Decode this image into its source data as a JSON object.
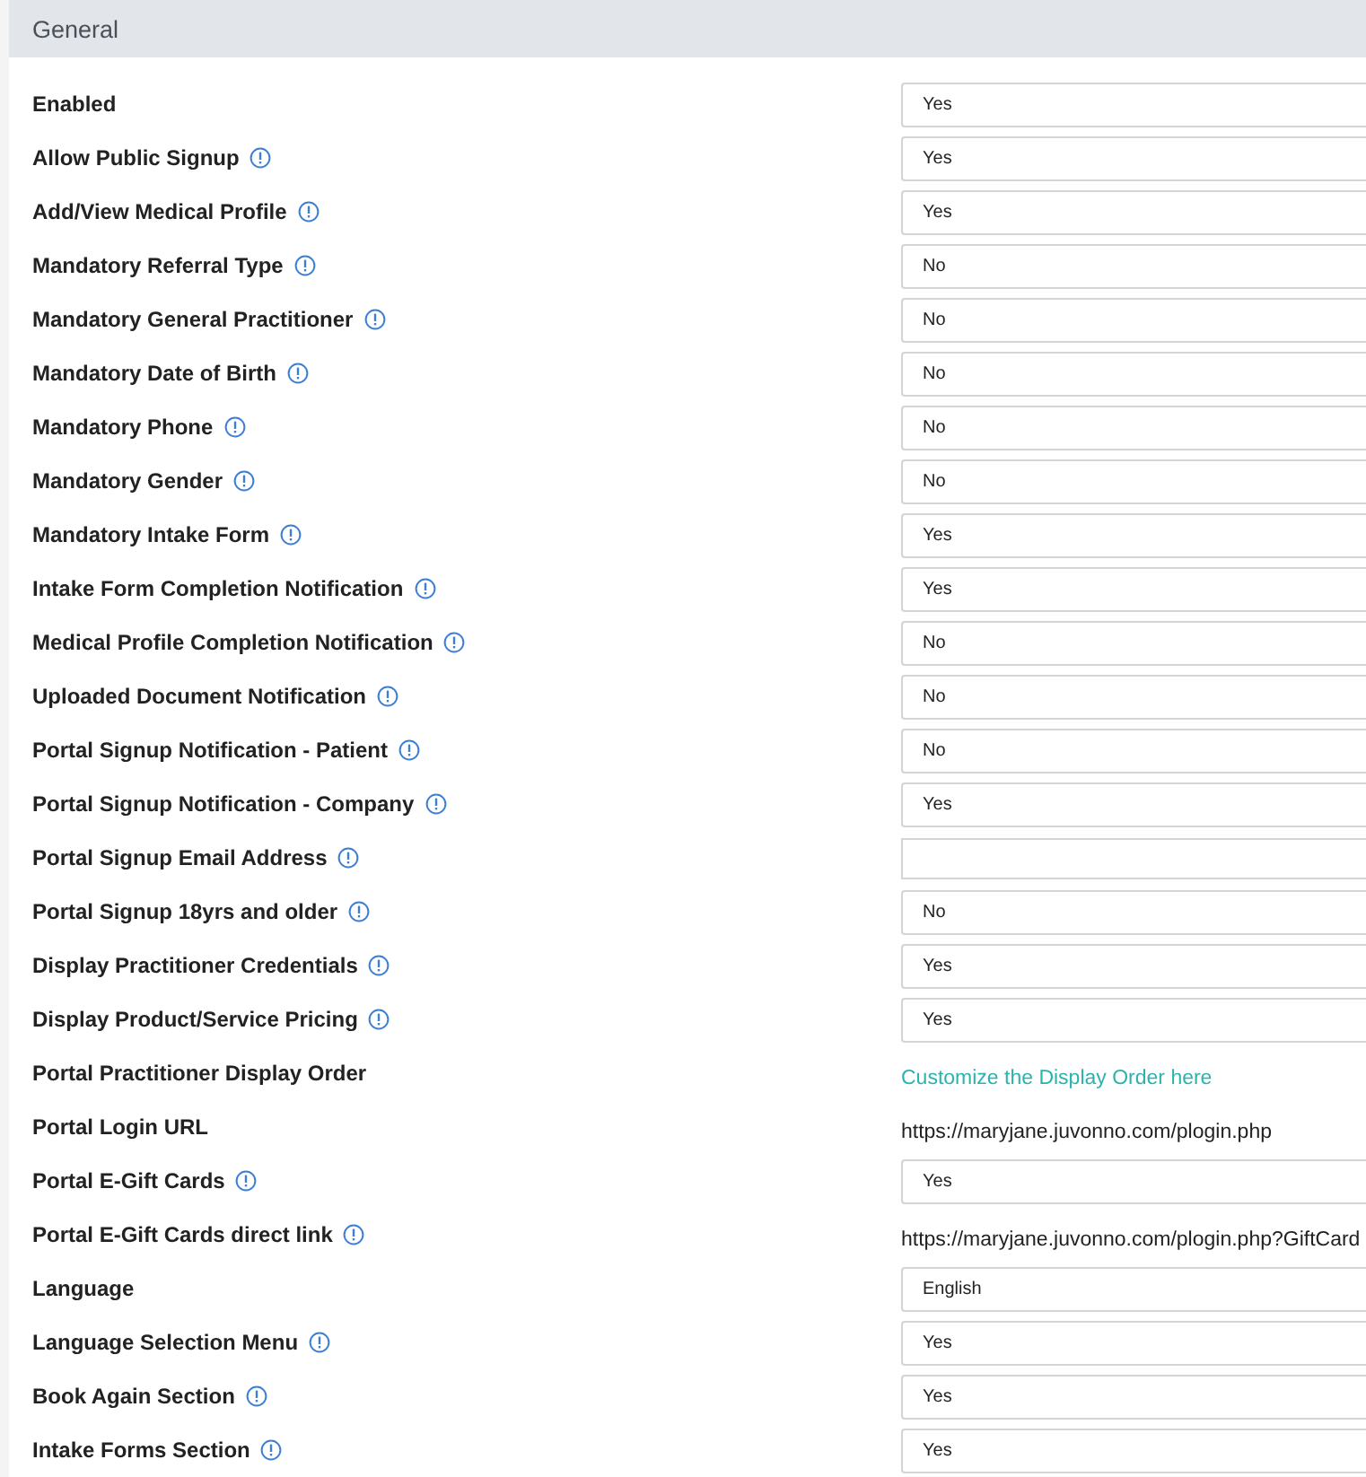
{
  "section": {
    "title": "General"
  },
  "settings": [
    {
      "label": "Enabled",
      "info": false,
      "kind": "select",
      "value": "Yes"
    },
    {
      "label": "Allow Public Signup",
      "info": true,
      "kind": "select",
      "value": "Yes"
    },
    {
      "label": "Add/View Medical Profile",
      "info": true,
      "kind": "select",
      "value": "Yes"
    },
    {
      "label": "Mandatory Referral Type",
      "info": true,
      "kind": "select",
      "value": "No"
    },
    {
      "label": "Mandatory General Practitioner",
      "info": true,
      "kind": "select",
      "value": "No"
    },
    {
      "label": "Mandatory Date of Birth",
      "info": true,
      "kind": "select",
      "value": "No"
    },
    {
      "label": "Mandatory Phone",
      "info": true,
      "kind": "select",
      "value": "No"
    },
    {
      "label": "Mandatory Gender",
      "info": true,
      "kind": "select",
      "value": "No"
    },
    {
      "label": "Mandatory Intake Form",
      "info": true,
      "kind": "select",
      "value": "Yes"
    },
    {
      "label": "Intake Form Completion Notification",
      "info": true,
      "kind": "select",
      "value": "Yes"
    },
    {
      "label": "Medical Profile Completion Notification",
      "info": true,
      "kind": "select",
      "value": "No"
    },
    {
      "label": "Uploaded Document Notification",
      "info": true,
      "kind": "select",
      "value": "No"
    },
    {
      "label": "Portal Signup Notification - Patient",
      "info": true,
      "kind": "select",
      "value": "No"
    },
    {
      "label": "Portal Signup Notification - Company",
      "info": true,
      "kind": "select",
      "value": "Yes"
    },
    {
      "label": "Portal Signup Email Address",
      "info": true,
      "kind": "input"
    },
    {
      "label": "Portal Signup 18yrs and older",
      "info": true,
      "kind": "select",
      "value": "No"
    },
    {
      "label": "Display Practitioner Credentials",
      "info": true,
      "kind": "select",
      "value": "Yes"
    },
    {
      "label": "Display Product/Service Pricing",
      "info": true,
      "kind": "select",
      "value": "Yes"
    },
    {
      "label": "Portal Practitioner Display Order",
      "info": false,
      "kind": "link",
      "value": "Customize the Display Order here"
    },
    {
      "label": "Portal Login URL",
      "info": false,
      "kind": "text",
      "value": "https://maryjane.juvonno.com/plogin.php"
    },
    {
      "label": "Portal E-Gift Cards",
      "info": true,
      "kind": "select",
      "value": "Yes"
    },
    {
      "label": "Portal E-Gift Cards direct link",
      "info": true,
      "kind": "text",
      "value": "https://maryjane.juvonno.com/plogin.php?GiftCard"
    },
    {
      "label": "Language",
      "info": false,
      "kind": "select",
      "value": "English"
    },
    {
      "label": "Language Selection Menu",
      "info": true,
      "kind": "select",
      "value": "Yes"
    },
    {
      "label": "Book Again Section",
      "info": true,
      "kind": "select",
      "value": "Yes"
    },
    {
      "label": "Intake Forms Section",
      "info": true,
      "kind": "select",
      "value": "Yes"
    }
  ]
}
